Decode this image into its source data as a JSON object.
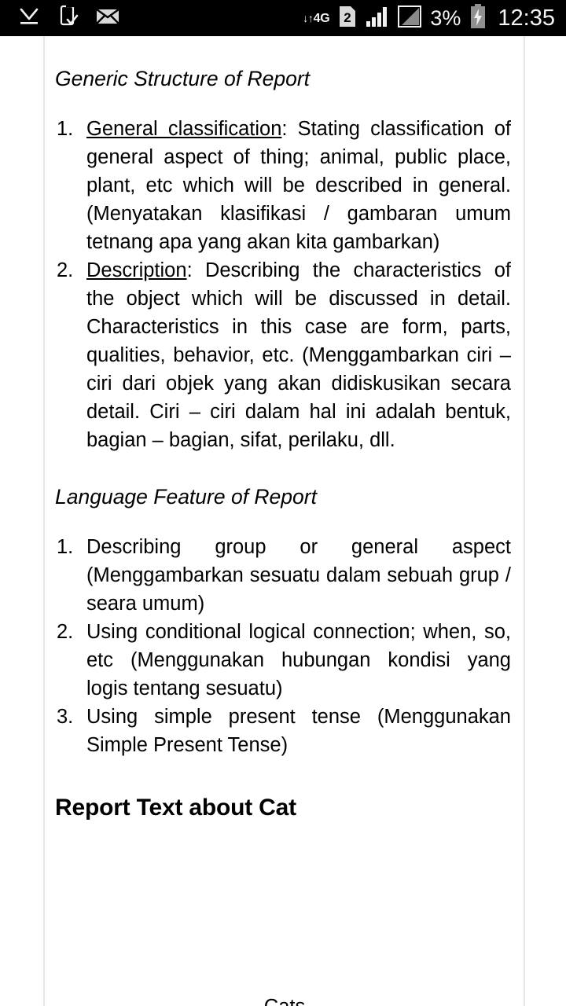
{
  "status_bar": {
    "background": "#000000",
    "foreground": "#f4f4f4",
    "left_icons": [
      {
        "name": "download-complete-icon",
        "glyph": "check-underline"
      },
      {
        "name": "phone-check-icon",
        "glyph": "phone-check"
      },
      {
        "name": "mail-icon",
        "glyph": "envelope"
      }
    ],
    "network_type": "4G",
    "network_arrows": "↓↑",
    "sim_slot": "2",
    "signal_bars": 4,
    "battery_percent": "3%",
    "clock": "12:35"
  },
  "document": {
    "headings": {
      "generic_structure": "Generic Structure of Report",
      "language_feature": "Language Feature of Report",
      "report_text_about_cat": "Report Text about Cat"
    },
    "generic_structure_list": [
      {
        "marker": "1.",
        "underlined": "General           classification",
        "rest": ": Stating classification of general aspect of thing; animal, public place, plant, etc which will be described in general. (Menyatakan klasifikasi / gambaran umum tetnang apa yang akan kita gambarkan)"
      },
      {
        "marker": "2.",
        "underlined": "Description",
        "rest": ": Describing the characteristics of the object which will be discussed in detail. Characteristics in this case are form, parts, qualities, behavior, etc. (Menggambarkan ciri – ciri dari objek yang akan didiskusikan secara detail. Ciri – ciri dalam hal ini adalah bentuk, bagian – bagian, sifat, perilaku, dll."
      }
    ],
    "language_feature_list": [
      {
        "marker": "1.",
        "text": "Describing group or general aspect (Menggambarkan sesuatu dalam sebuah grup / seara umum)"
      },
      {
        "marker": "2.",
        "text": "Using conditional logical connection; when, so, etc (Menggunakan hubungan kondisi yang logis tentang sesuatu)"
      },
      {
        "marker": "3.",
        "text": "Using simple present tense (Menggunakan Simple Present Tense)"
      }
    ],
    "bottom_partial_text": "Cats"
  }
}
